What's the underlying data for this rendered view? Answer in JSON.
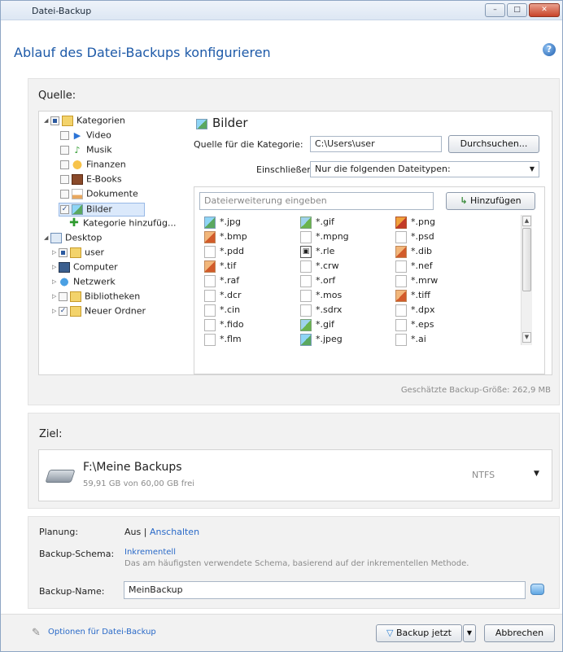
{
  "window": {
    "title": "Datei-Backup",
    "minimize": "–",
    "maximize": "□",
    "close": "✕"
  },
  "heading": "Ablauf des Datei-Backups konfigurieren",
  "help": "?",
  "source": {
    "heading": "Quelle:",
    "tree": [
      {
        "label": "Kategorien"
      },
      {
        "label": "Video"
      },
      {
        "label": "Musik"
      },
      {
        "label": "Finanzen"
      },
      {
        "label": "E-Books"
      },
      {
        "label": "Dokumente"
      },
      {
        "label": "Bilder"
      },
      {
        "label": "Kategorie hinzufüg..."
      },
      {
        "label": "Desktop"
      },
      {
        "label": "user"
      },
      {
        "label": "Computer"
      },
      {
        "label": "Netzwerk"
      },
      {
        "label": "Bibliotheken"
      },
      {
        "label": "Neuer Ordner"
      }
    ],
    "category_title": "Bilder",
    "source_label": "Quelle für die Kategorie:",
    "source_value": "C:\\Users\\user",
    "browse_button": "Durchsuchen...",
    "include_label": "Einschließen:",
    "include_value": "Nur die folgenden Dateitypen:",
    "extension_placeholder": "Dateierweiterung eingeben",
    "add_button": "Hinzufügen",
    "file_types": [
      "*.jpg",
      "*.gif",
      "*.png",
      "*.bmp",
      "*.mpng",
      "*.psd",
      "*.pdd",
      "*.rle",
      "*.dib",
      "*.tif",
      "*.crw",
      "*.nef",
      "*.raf",
      "*.orf",
      "*.mrw",
      "*.dcr",
      "*.mos",
      "*.tiff",
      "*.cin",
      "*.sdrx",
      "*.dpx",
      "*.fido",
      "*.gif",
      "*.eps",
      "*.flm",
      "*.jpeg",
      "*.ai"
    ],
    "estimated_size": "Geschätzte Backup-Größe: 262,9 MB"
  },
  "target": {
    "heading": "Ziel:",
    "path": "F:\\Meine Backups",
    "free": "59,91 GB von 60,00 GB frei",
    "filesystem": "NTFS"
  },
  "settings": {
    "schedule_label": "Planung:",
    "schedule_off": "Aus",
    "schedule_sep": "|",
    "schedule_on": "Anschalten",
    "scheme_label": "Backup-Schema:",
    "scheme_value": "Inkrementell",
    "scheme_desc": "Das am häufigsten verwendete Schema, basierend auf der inkrementellen Methode.",
    "name_label": "Backup-Name:",
    "name_value": "MeinBackup"
  },
  "footer": {
    "options_link": "Optionen für Datei-Backup",
    "backup_now": "Backup jetzt",
    "cancel": "Abbrechen"
  }
}
